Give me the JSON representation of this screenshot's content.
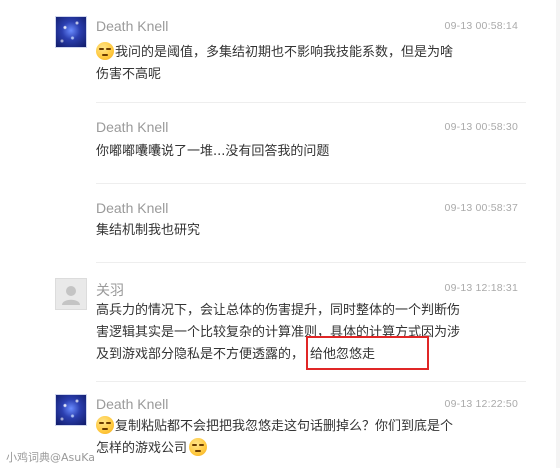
{
  "comments": [
    {
      "username": "Death Knell",
      "timestamp": "09-13 00:58:14",
      "text_line1": "我问的是阈值，多集结初期也不影响我技能系数，但是为啥",
      "text_line2": "伤害不高呢",
      "emoji": "sweat-smile-emoji"
    },
    {
      "username": "Death Knell",
      "timestamp": "09-13 00:58:30",
      "text_line1": "你嘟嘟囔囔说了一堆...没有回答我的问题"
    },
    {
      "username": "Death Knell",
      "timestamp": "09-13 00:58:37",
      "text_line1": "集结机制我也研究"
    },
    {
      "username": "关羽",
      "timestamp": "09-13 12:18:31",
      "text_line1": "高兵力的情况下，会让总体的伤害提升，同时整体的一个判断伤",
      "text_line2": "害逻辑其实是一个比较复杂的计算准则，具体的计算方式因为涉",
      "text_line3a": "及到游戏部分隐私是不方便透露的，",
      "text_line3b": "给他忽悠走"
    },
    {
      "username": "Death Knell",
      "timestamp": "09-13 12:22:50",
      "text_line1": "复制粘贴都不会把把我忽悠走这句话删掉么？你们到底是个",
      "text_line2": "怎样的游戏公司",
      "emoji": "smirk-emoji"
    }
  ],
  "watermark": "小鸡词典@AsuKa"
}
